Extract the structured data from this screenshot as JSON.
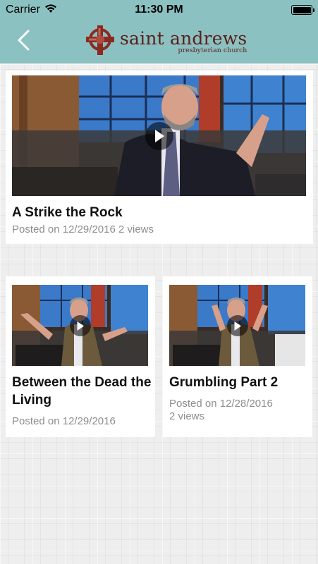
{
  "status_bar": {
    "carrier": "Carrier",
    "time": "11:30 PM"
  },
  "header": {
    "logo_name": "saint andrews",
    "logo_sub": "presbyterian church",
    "accent_color": "#8cc1c1",
    "logo_color": "#8b2a22",
    "icons": [
      "back-chevron-icon",
      "celtic-cross-icon"
    ]
  },
  "videos": [
    {
      "title": "A Strike the Rock",
      "posted_label": "Posted on",
      "date": "12/29/2016",
      "views": "2 views"
    },
    {
      "title": "Between the Dead  the Living",
      "posted_label": "Posted on",
      "date": "12/29/2016",
      "views": ""
    },
    {
      "title": "Grumbling Part 2",
      "posted_label": "Posted on",
      "date": "12/28/2016",
      "views": "2 views"
    }
  ]
}
